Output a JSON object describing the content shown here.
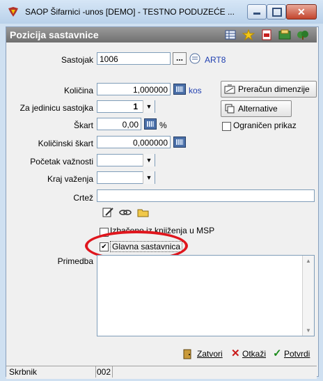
{
  "window": {
    "title": "SAOP Šifarnici -unos [DEMO] - TESTNO PODUZEĆE ...",
    "controls": {
      "minimize": "–",
      "maximize": "□",
      "close": "✕"
    }
  },
  "header": {
    "title": "Pozicija sastavnice",
    "icons": [
      "grid-icon",
      "star-icon",
      "pdf-icon",
      "export-icon",
      "tree-icon"
    ]
  },
  "form": {
    "sastojak": {
      "label": "Sastojak",
      "value": "1006",
      "ellipsis": "...",
      "link": "ART8"
    },
    "kolicina": {
      "label": "Količina",
      "value": "1,000000",
      "unit": "kos"
    },
    "za_jedinicu": {
      "label": "Za jedinicu sastojka",
      "value": "1"
    },
    "skart": {
      "label": "Škart",
      "value": "0,00",
      "unit": "%"
    },
    "kolicinski_skart": {
      "label": "Količinski škart",
      "value": "0,000000"
    },
    "pocetak_vaznosti": {
      "label": "Početak važnosti",
      "value": ""
    },
    "kraj_vazenja": {
      "label": "Kraj važenja",
      "value": ""
    },
    "crtez": {
      "label": "Crtež",
      "value": ""
    },
    "izbaceno_msp": {
      "label": "Izbačeno iz knjiženja u MSP",
      "checked": false
    },
    "glavna_sastavnica": {
      "label": "Glavna sastavnica",
      "checked": true
    },
    "primedba": {
      "label": "Primedba",
      "value": ""
    }
  },
  "right_panel": {
    "preracun": "Preračun dimenzije",
    "alternative": "Alternative",
    "ogranicen_prikaz": {
      "label": "Ograničen prikaz",
      "checked": false
    }
  },
  "buttons": {
    "zatvori": "Zatvori",
    "otkazi": "Otkaži",
    "potvrdi": "Potvrdi"
  },
  "status": {
    "user_label": "Skrbnik",
    "code": "002"
  },
  "colors": {
    "highlight": "#e0161d",
    "header_bg": "#808080",
    "link": "#1f3fb0"
  }
}
